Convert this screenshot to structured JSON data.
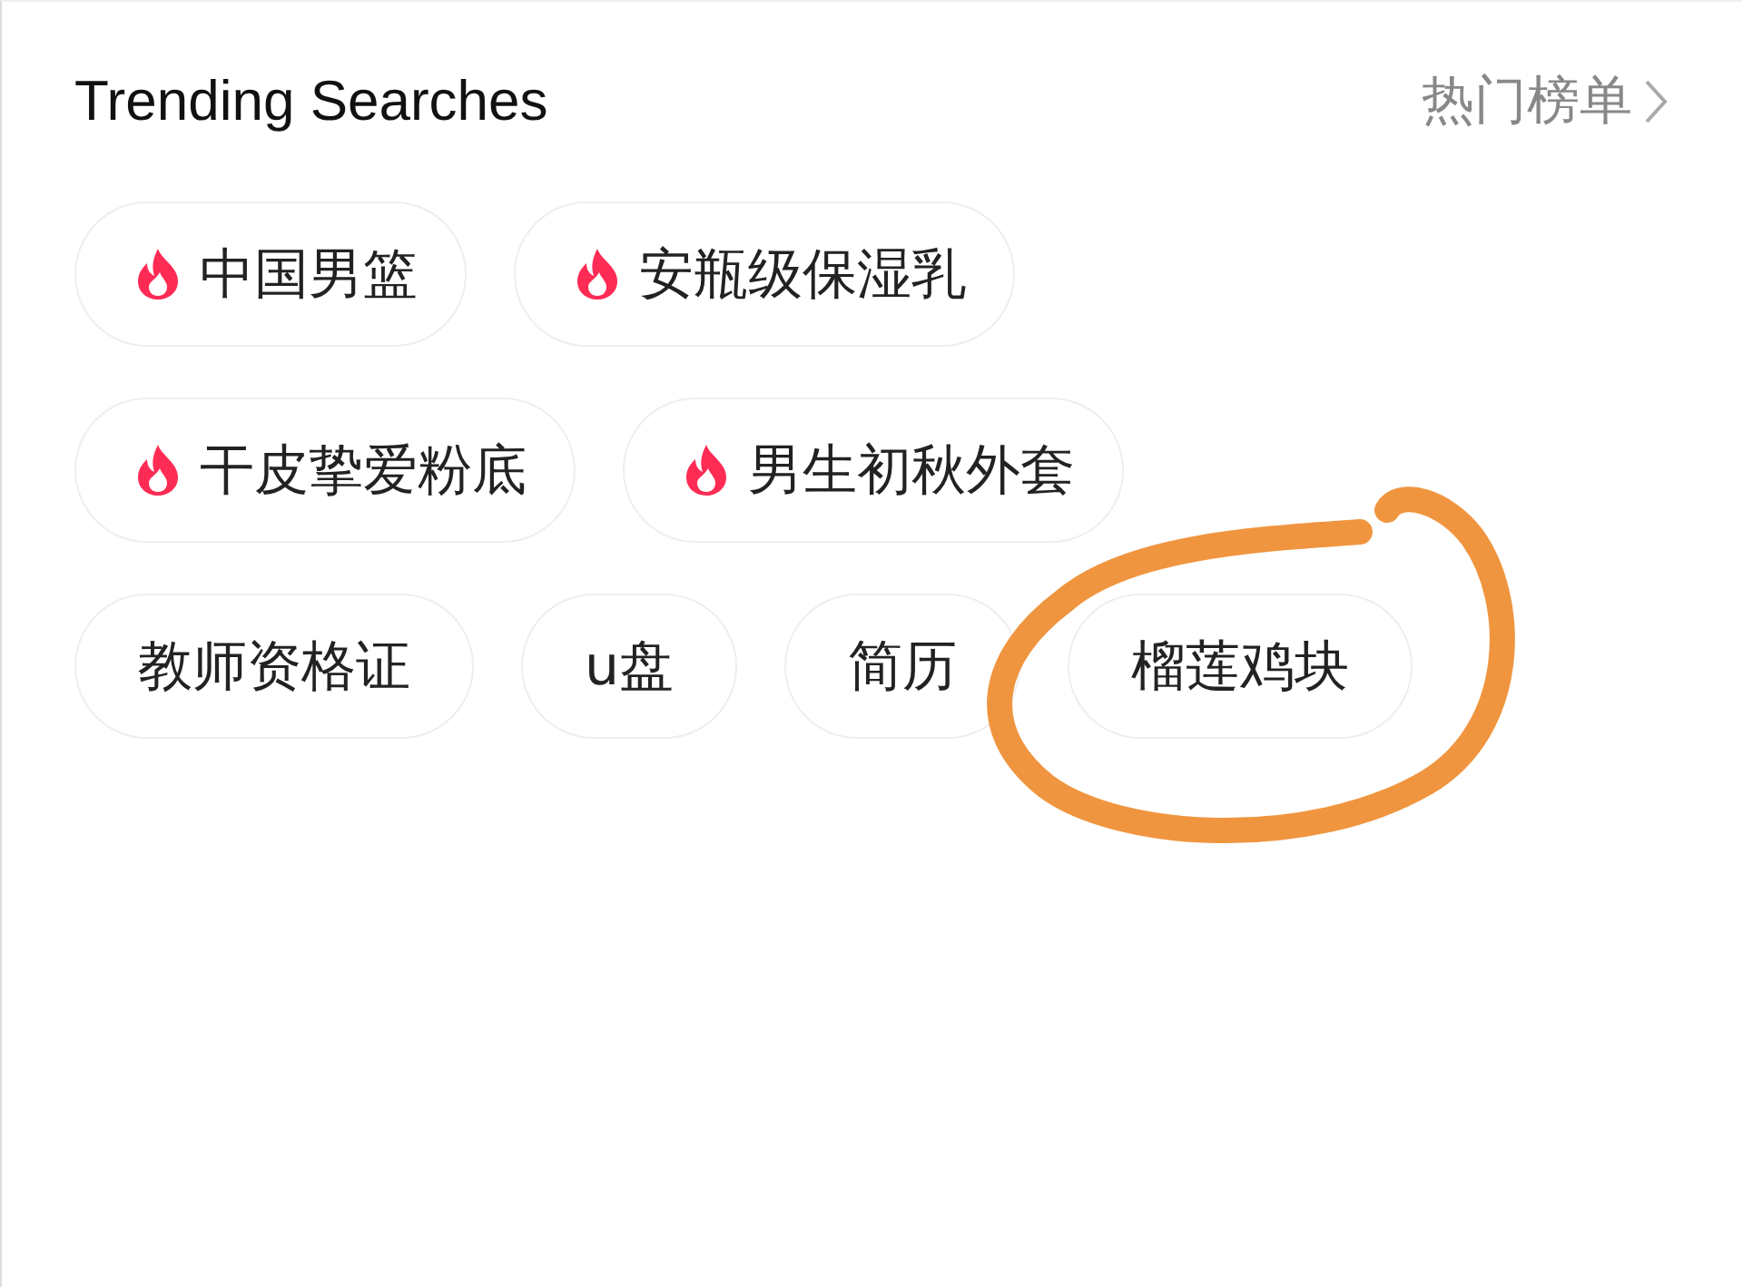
{
  "header": {
    "title": "Trending Searches",
    "link": "热门榜单"
  },
  "chip_rows": [
    [
      {
        "label": "中国男篮",
        "hot": true
      },
      {
        "label": "安瓶级保湿乳",
        "hot": true
      }
    ],
    [
      {
        "label": "干皮挚爱粉底",
        "hot": true
      },
      {
        "label": "男生初秋外套",
        "hot": true
      }
    ],
    [
      {
        "label": "教师资格证",
        "hot": false
      },
      {
        "label": "u盘",
        "hot": false
      },
      {
        "label": "简历",
        "hot": false
      },
      {
        "label": "榴莲鸡块",
        "hot": false
      }
    ]
  ]
}
